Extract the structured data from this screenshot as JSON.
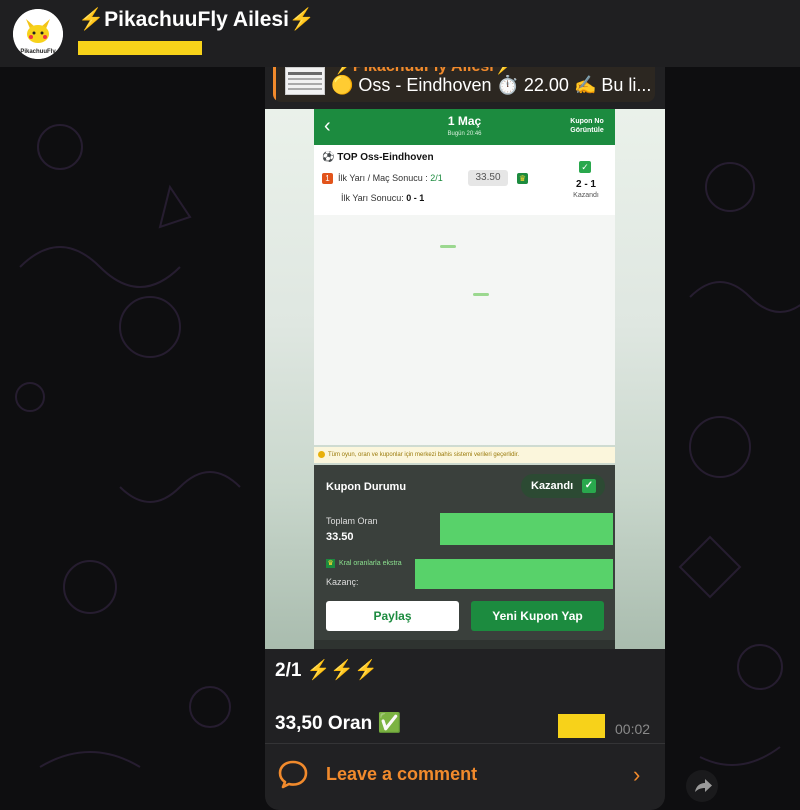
{
  "header": {
    "channel_title": "⚡️PikachuuFly Ailesi⚡️",
    "avatar_text": "PikachuuFly"
  },
  "reply": {
    "sender": "⚡️PikachuuFly Ailesi⚡️",
    "text": "🟡 Oss - Eindhoven ⏱️ 22.00 ✍️ Bu li..."
  },
  "screenshot": {
    "top_title": "1 Maç",
    "top_subtitle": "Bugün 20:46",
    "kupon_button": "Kupon No Görüntüle",
    "match_name": "⚽ TOP Oss-Eindhoven",
    "bet_number": "1",
    "bet_label": "İlk Yarı / Maç Sonucu :",
    "bet_pick": "2/1",
    "odds": "33.50",
    "result_score": "2 - 1",
    "result_status": "Kazandı",
    "ht_label": "İlk Yarı Sonucu:",
    "ht_score": "0 - 1",
    "warning": "Tüm oyun, oran ve kuponlar için merkezi bahis sistemi verileri geçerlidir.",
    "coupon_status_label": "Kupon Durumu",
    "coupon_status_value": "Kazandı",
    "total_odds_label": "Toplam Oran",
    "total_odds_value": "33.50",
    "kral_text": "Kral oranlarla ekstra",
    "win_label": "Kazanç:",
    "share_button": "Paylaş",
    "new_coupon_button": "Yeni Kupon Yap"
  },
  "message": {
    "line1": "2/1 ⚡⚡⚡",
    "line2": "33,50 Oran ✅",
    "time": "00:02"
  },
  "comments": {
    "label": "Leave a comment"
  },
  "colors": {
    "accent": "#f18a2c",
    "brand_green": "#1c8b3f",
    "highlight_yellow": "#f7d21a"
  }
}
